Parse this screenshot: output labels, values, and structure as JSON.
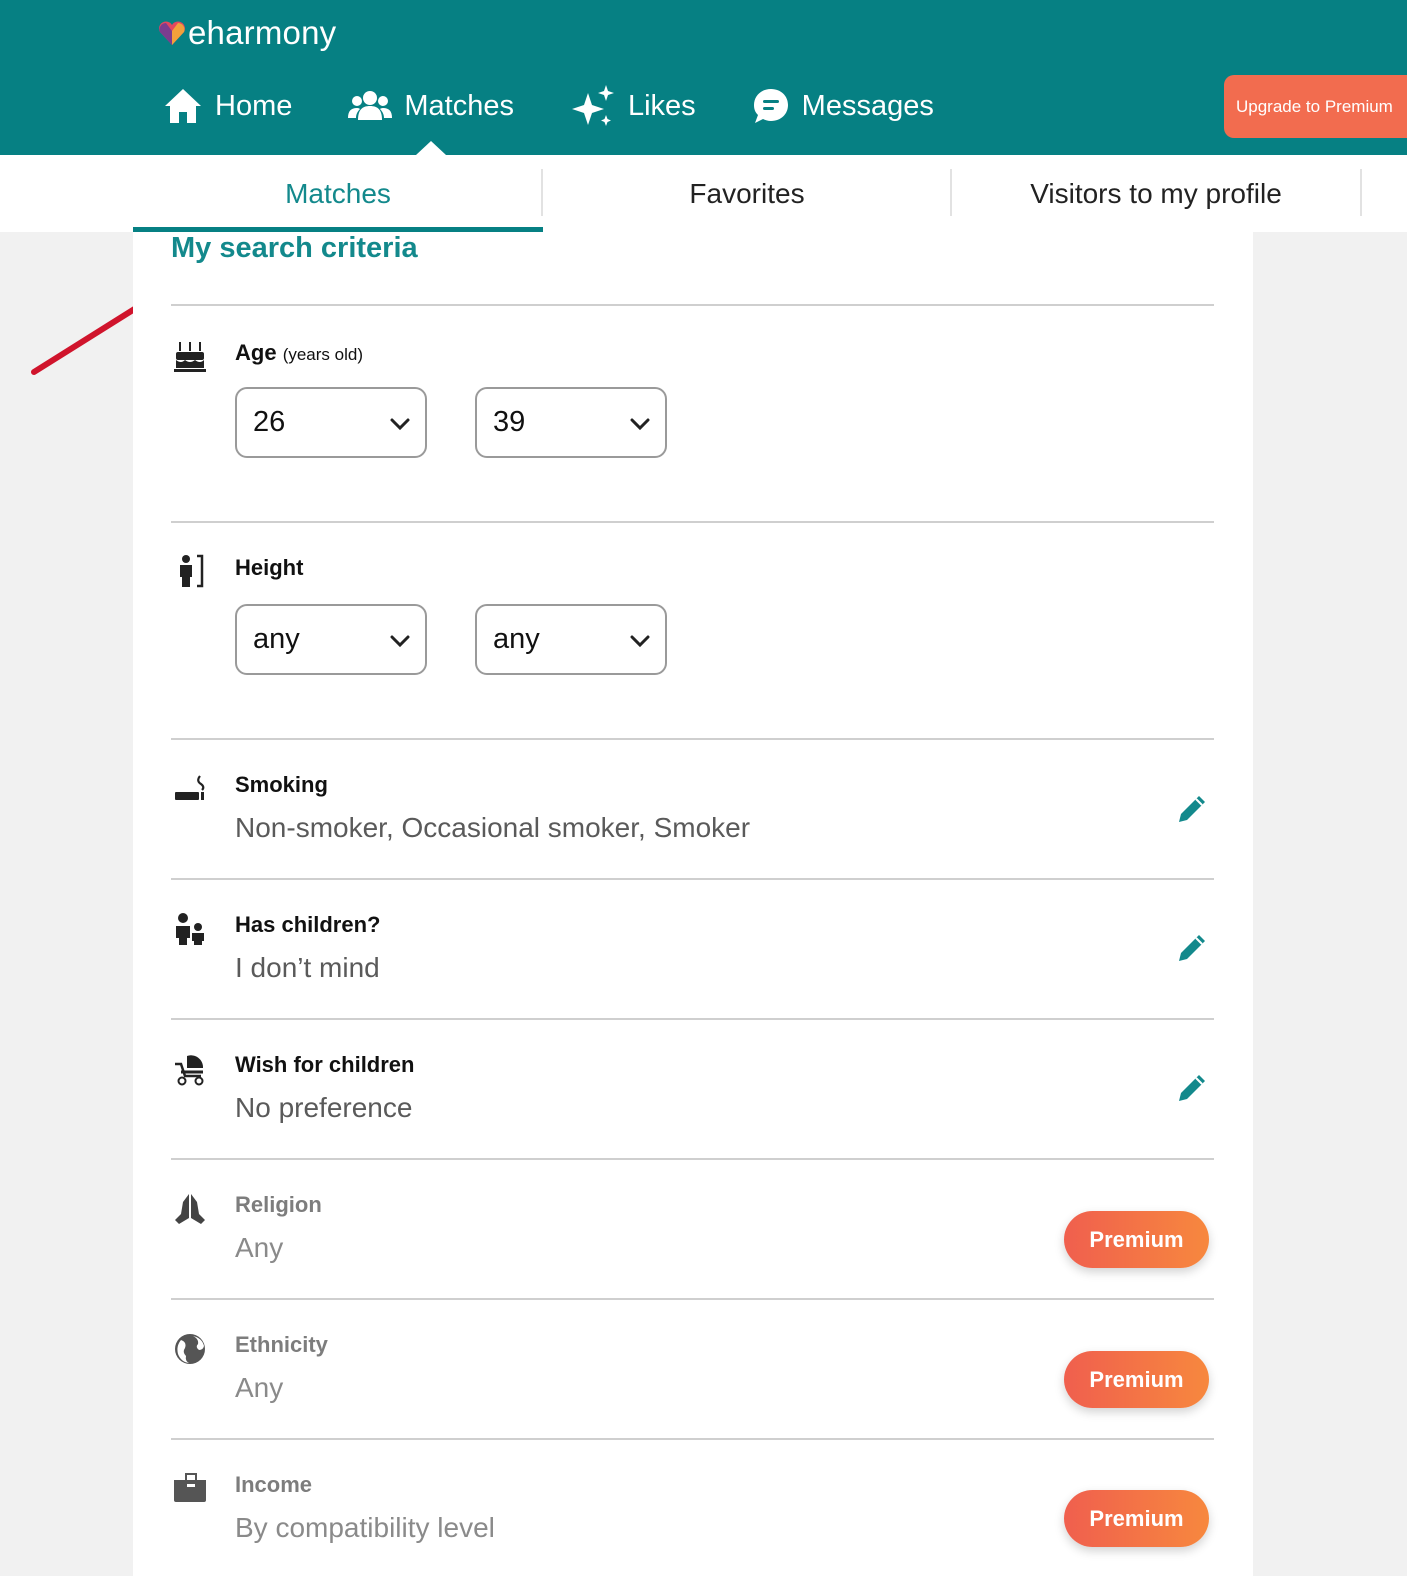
{
  "brand": {
    "name": "eharmony"
  },
  "nav": {
    "items": [
      {
        "label": "Home",
        "icon": "home-icon"
      },
      {
        "label": "Matches",
        "icon": "people-icon"
      },
      {
        "label": "Likes",
        "icon": "sparkles-icon"
      },
      {
        "label": "Messages",
        "icon": "chat-bubble-icon"
      }
    ],
    "upgrade_label": "Upgrade to Premium"
  },
  "tabs": [
    {
      "label": "Matches",
      "active": true
    },
    {
      "label": "Favorites",
      "active": false
    },
    {
      "label": "Visitors to my profile",
      "active": false
    }
  ],
  "search": {
    "title": "My search criteria",
    "age": {
      "label": "Age",
      "sublabel": "(years old)",
      "min": "26",
      "max": "39",
      "icon": "birthday-cake-icon"
    },
    "height": {
      "label": "Height",
      "min": "any",
      "max": "any",
      "icon": "height-icon"
    },
    "smoking": {
      "label": "Smoking",
      "value": "Non-smoker, Occasional smoker, Smoker",
      "icon": "cigarette-icon"
    },
    "has_children": {
      "label": "Has children?",
      "value": "I don’t mind",
      "icon": "family-icon"
    },
    "wish_children": {
      "label": "Wish for children",
      "value": "No preference",
      "icon": "stroller-icon"
    },
    "religion": {
      "label": "Religion",
      "value": "Any",
      "icon": "praying-hands-icon",
      "button": "Premium"
    },
    "ethnicity": {
      "label": "Ethnicity",
      "value": "Any",
      "icon": "globe-icon",
      "button": "Premium"
    },
    "income": {
      "label": "Income",
      "value": "By compatibility level",
      "icon": "wallet-icon",
      "button": "Premium"
    }
  },
  "colors": {
    "brand_teal": "#068083",
    "accent_orange": "#f26c4f",
    "annotation_red": "#d0142c"
  }
}
